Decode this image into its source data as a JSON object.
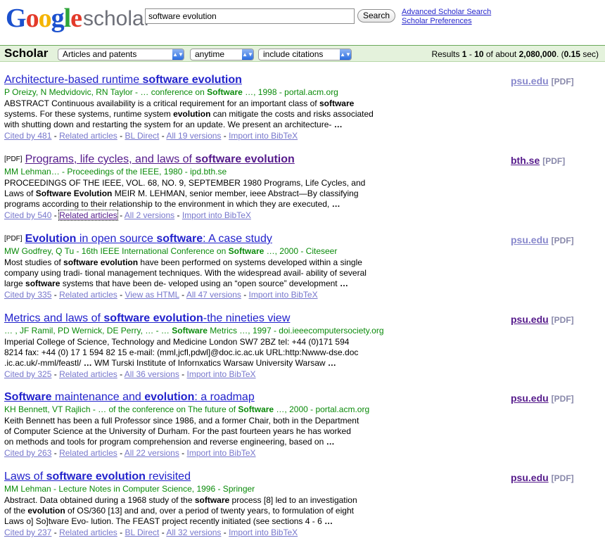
{
  "header": {
    "logo_letters": [
      "G",
      "o",
      "o",
      "g",
      "l",
      "e"
    ],
    "logo_suffix": "scholar",
    "search_value": "software evolution",
    "search_button": "Search",
    "advanced_link": "Advanced Scholar Search",
    "preferences_link": "Scholar Preferences"
  },
  "bar": {
    "title": "Scholar",
    "filter_type": "Articles and patents",
    "filter_time": "anytime",
    "filter_citations": "include citations",
    "results_prefix": "Results ",
    "results_range_start": "1",
    "results_dash": " - ",
    "results_range_end": "10",
    "results_mid": " of about ",
    "results_total": "2,080,000",
    "results_time_prefix": ". (",
    "results_time": "0.15",
    "results_suffix": " sec)"
  },
  "results": [
    {
      "title_parts": [
        "Architecture-based runtime ",
        "software evolution"
      ],
      "meta": "P Oreizy, N Medvidovic, RN Taylor - … conference on Software …, 1998 - portal.acm.org",
      "snippet_lines": [
        "ABSTRACT Continuous availability is a critical requirement for an important class of software",
        "systems. For these systems, runtime system evolution can mitigate the costs and risks associated",
        "with shutting down and restarting the system for an update. We present an architecture- …"
      ],
      "links": [
        "Cited by 481",
        "Related articles",
        "BL Direct",
        "All 19 versions",
        "Import into BibTeX"
      ],
      "side_domain": "psu.edu",
      "side_pdf": "[PDF]"
    },
    {
      "pdf_tag": "[PDF]",
      "title_parts": [
        "Programs, life cycles, and laws of ",
        "software evolution"
      ],
      "meta": "MM Lehman… - Proceedings of the IEEE, 1980 - ipd.bth.se",
      "snippet_lines": [
        "PROCEEDINGS OF THE IEEE, VOL. 68, NO. 9, SEPTEMBER 1980 Programs, Life Cycles, and",
        "Laws of Software Evolution MEIR M. LEHMAN, senior member, ieee Abstract—By classifying",
        "programs according to their relationship to the environment in which they are executed, …"
      ],
      "links": [
        "Cited by 540",
        "Related articles",
        "All 2 versions",
        "Import into BibTeX"
      ],
      "side_domain": "bth.se",
      "side_pdf": "[PDF]"
    },
    {
      "pdf_tag": "[PDF]",
      "title_parts": [
        "Evolution",
        " in open source ",
        "software",
        ": A case study"
      ],
      "meta": "MW Godfrey, Q Tu - 16th IEEE International Conference on Software …, 2000 - Citeseer",
      "snippet_lines": [
        "Most studies of software evolution have been performed on systems developed within a single",
        "company using tradi- tional management techniques. With the widespread avail- ability of several",
        "large software systems that have been de- veloped using an “open source” development …"
      ],
      "links": [
        "Cited by 335",
        "Related articles",
        "View as HTML",
        "All 47 versions",
        "Import into BibTeX"
      ],
      "side_domain": "psu.edu",
      "side_pdf": "[PDF]"
    },
    {
      "title_parts": [
        "Metrics and laws of ",
        "software evolution",
        "-the nineties view"
      ],
      "meta": "… , JF Ramil, PD Wernick, DE Perry, … - … Software Metrics …, 1997 - doi.ieeecomputersociety.org",
      "snippet_lines": [
        "Imperial College of Science, Technology and Medicine London SW7 2BZ tel: +44 (0)171 594",
        "8214 fax: +44 (0) 17 1 594 82 15 e-mail: (mml,jcfl,pdwl]@doc.ic.ac.uk URL:http:Nwww-dse.doc",
        ".ic.ac.uk/-mml/feastl/ … WM Turski Institute of Infornxatics Warsaw University Warsaw …"
      ],
      "links": [
        "Cited by 325",
        "Related articles",
        "All 36 versions",
        "Import into BibTeX"
      ],
      "side_domain": "psu.edu",
      "side_pdf": "[PDF]"
    },
    {
      "title_parts": [
        "Software",
        " maintenance and ",
        "evolution",
        ": a roadmap"
      ],
      "meta": "KH Bennett, VT Rajlich - … of the conference on The future of Software …, 2000 - portal.acm.org",
      "snippet_lines": [
        "Keith Bennett has been a full Professor since 1986, and a former Chair, both in the Department",
        "of Computer Science at the University of Durham. For the past fourteen years he has worked",
        "on methods and tools for program comprehension and reverse engineering, based on …"
      ],
      "links": [
        "Cited by 263",
        "Related articles",
        "All 22 versions",
        "Import into BibTeX"
      ],
      "side_domain": "psu.edu",
      "side_pdf": "[PDF]"
    },
    {
      "title_parts": [
        "Laws of ",
        "software evolution",
        " revisited"
      ],
      "meta": "MM Lehman - Lecture Notes in Computer Science, 1996 - Springer",
      "snippet_lines": [
        "Abstract. Data obtained during a 1968 study of the software process [8] led to an investigation",
        "of the evolution of OS/360 [13] and and, over a period of twenty years, to formulation of eight",
        "Laws o] So]tware Evo- lution. The FEAST project recently initiated (see sections 4 - 6 …"
      ],
      "links": [
        "Cited by 237",
        "Related articles",
        "BL Direct",
        "All 32 versions",
        "Import into BibTeX"
      ],
      "side_domain": "psu.edu",
      "side_pdf": "[PDF]"
    }
  ],
  "colors": {
    "link": "#2222cc",
    "visited": "#551a8b",
    "meta_green": "#0a8a0a",
    "bar_bg": "#e4f2dc"
  }
}
